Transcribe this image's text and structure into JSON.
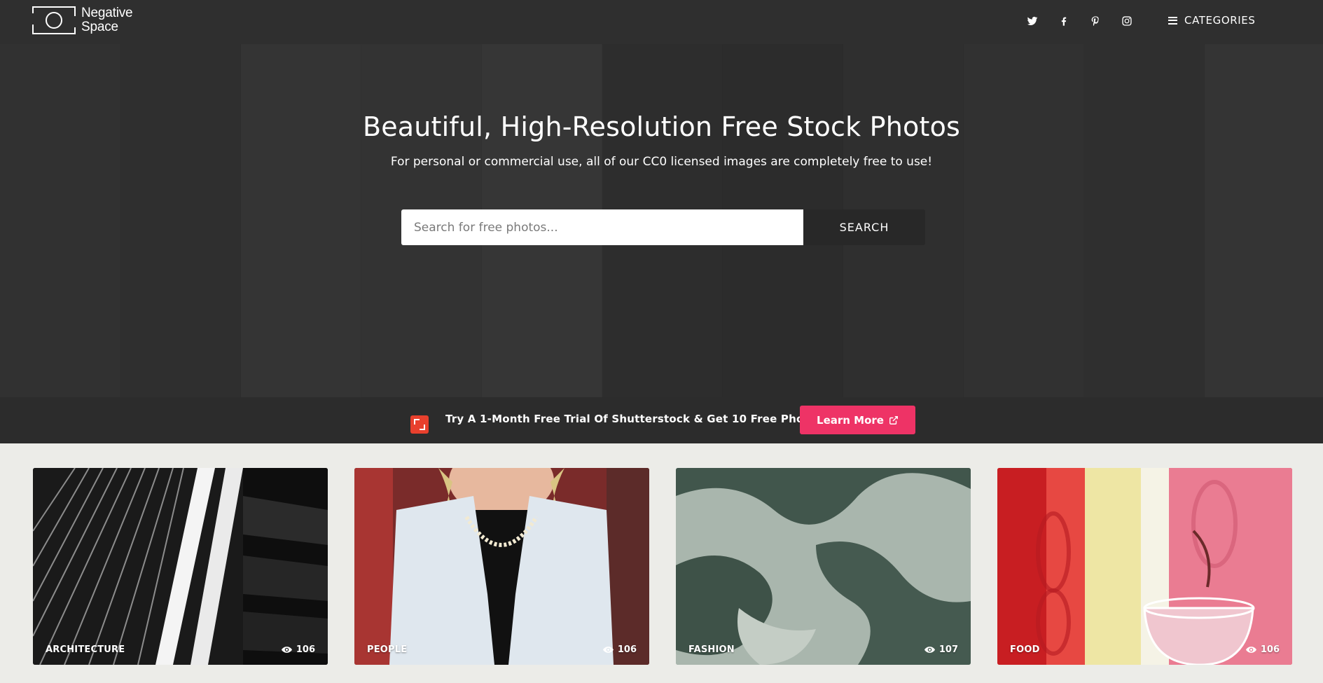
{
  "header": {
    "logo_text_line1": "Negative",
    "logo_text_line2": "Space",
    "social": [
      {
        "name": "twitter-icon"
      },
      {
        "name": "facebook-icon"
      },
      {
        "name": "pinterest-icon"
      },
      {
        "name": "instagram-icon"
      }
    ],
    "categories_label": "CATEGORIES"
  },
  "hero": {
    "title": "Beautiful, High-Resolution Free Stock Photos",
    "subtitle": "For personal or commercial use, all of our CC0 licensed images are completely free to use!",
    "search": {
      "placeholder": "Search for free photos...",
      "button_label": "SEARCH"
    }
  },
  "promo": {
    "text": "Try A 1-Month Free Trial Of Shutterstock & Get 10 Free Photos",
    "button_label": "Learn More",
    "brand_color": "#ee3366",
    "shutterstock_color": "#e8402d"
  },
  "cards": [
    {
      "category": "ARCHITECTURE",
      "views": "106"
    },
    {
      "category": "PEOPLE",
      "views": "106"
    },
    {
      "category": "FASHION",
      "views": "107"
    },
    {
      "category": "FOOD",
      "views": "106"
    }
  ]
}
